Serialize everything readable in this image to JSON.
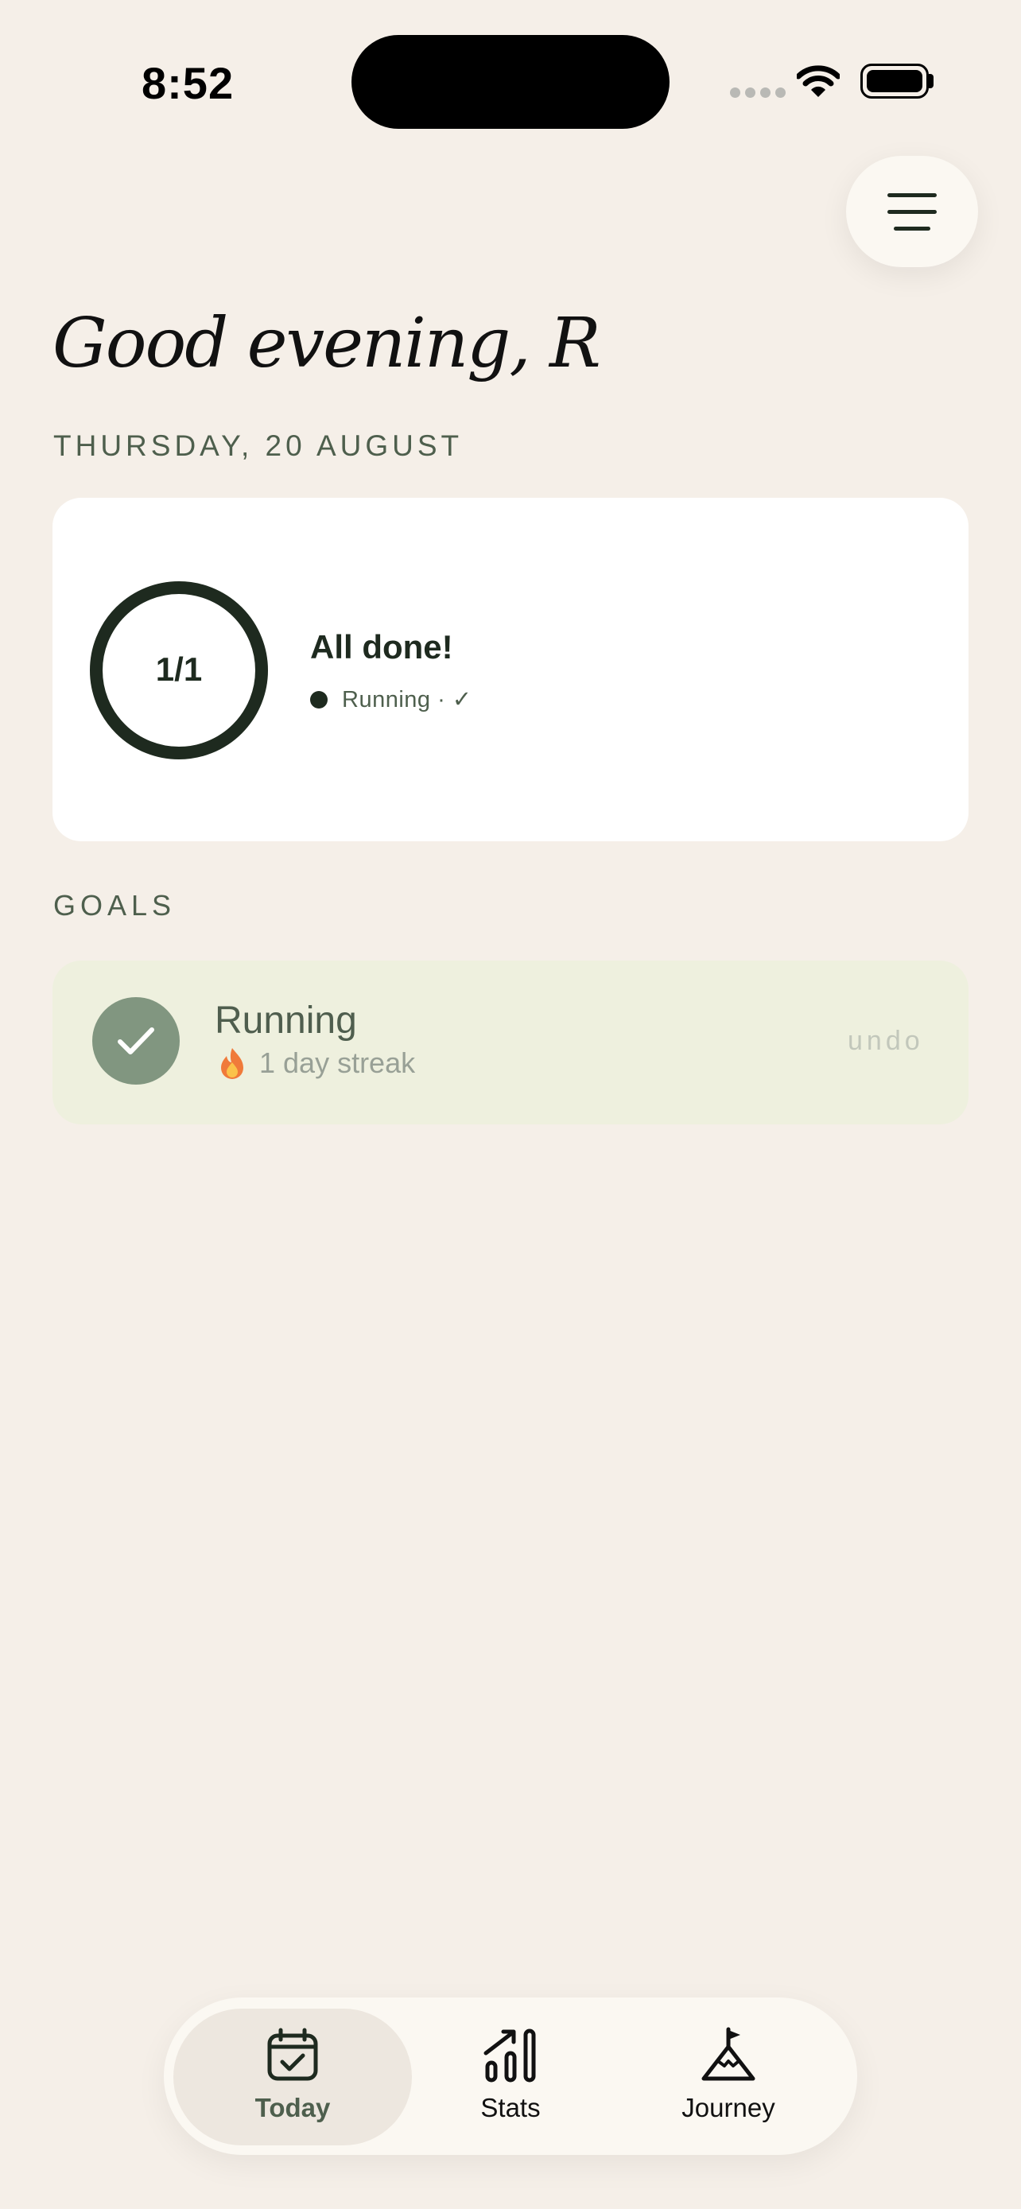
{
  "status_bar": {
    "time": "8:52"
  },
  "header": {
    "greeting": "Good evening, R",
    "date": "THURSDAY, 20 AUGUST"
  },
  "summary": {
    "progress_text": "1/1",
    "progress_fraction": 1.0,
    "title": "All done!",
    "status": "Running · ✓"
  },
  "goals": {
    "heading": "GOALS",
    "items": [
      {
        "name": "Running",
        "streak": "1 day streak",
        "action": "undo",
        "completed": true
      }
    ]
  },
  "tabbar": {
    "tabs": [
      {
        "label": "Today",
        "icon": "calendar-check-icon",
        "active": true
      },
      {
        "label": "Stats",
        "icon": "stats-icon",
        "active": false
      },
      {
        "label": "Journey",
        "icon": "mountain-flag-icon",
        "active": false
      }
    ]
  },
  "colors": {
    "background": "#F5EFE8",
    "accent_dark": "#1E2A1F",
    "goal_bg": "#EEF0DE",
    "check_green": "#819680"
  }
}
